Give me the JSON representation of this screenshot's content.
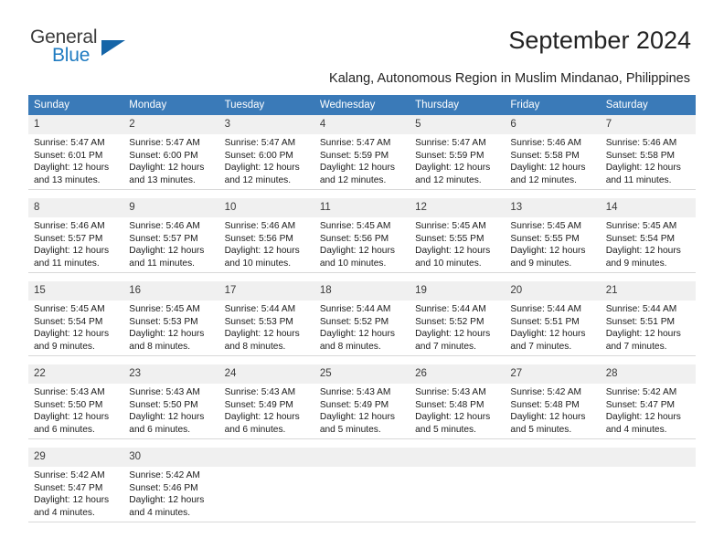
{
  "brand": {
    "name_top": "General",
    "name_bottom": "Blue",
    "color_dark": "#3c3c3c",
    "color_blue": "#1f7bc1",
    "triangle_color": "#1565a8"
  },
  "header": {
    "title": "September 2024",
    "subtitle": "Kalang, Autonomous Region in Muslim Mindanao, Philippines",
    "header_bg": "#3a7ab8",
    "header_text_color": "#ffffff",
    "daynum_bg": "#f0f0f0"
  },
  "weekday_headers": [
    "Sunday",
    "Monday",
    "Tuesday",
    "Wednesday",
    "Thursday",
    "Friday",
    "Saturday"
  ],
  "weeks": [
    [
      {
        "day": "1",
        "sunrise": "Sunrise: 5:47 AM",
        "sunset": "Sunset: 6:01 PM",
        "daylight_1": "Daylight: 12 hours",
        "daylight_2": "and 13 minutes."
      },
      {
        "day": "2",
        "sunrise": "Sunrise: 5:47 AM",
        "sunset": "Sunset: 6:00 PM",
        "daylight_1": "Daylight: 12 hours",
        "daylight_2": "and 13 minutes."
      },
      {
        "day": "3",
        "sunrise": "Sunrise: 5:47 AM",
        "sunset": "Sunset: 6:00 PM",
        "daylight_1": "Daylight: 12 hours",
        "daylight_2": "and 12 minutes."
      },
      {
        "day": "4",
        "sunrise": "Sunrise: 5:47 AM",
        "sunset": "Sunset: 5:59 PM",
        "daylight_1": "Daylight: 12 hours",
        "daylight_2": "and 12 minutes."
      },
      {
        "day": "5",
        "sunrise": "Sunrise: 5:47 AM",
        "sunset": "Sunset: 5:59 PM",
        "daylight_1": "Daylight: 12 hours",
        "daylight_2": "and 12 minutes."
      },
      {
        "day": "6",
        "sunrise": "Sunrise: 5:46 AM",
        "sunset": "Sunset: 5:58 PM",
        "daylight_1": "Daylight: 12 hours",
        "daylight_2": "and 12 minutes."
      },
      {
        "day": "7",
        "sunrise": "Sunrise: 5:46 AM",
        "sunset": "Sunset: 5:58 PM",
        "daylight_1": "Daylight: 12 hours",
        "daylight_2": "and 11 minutes."
      }
    ],
    [
      {
        "day": "8",
        "sunrise": "Sunrise: 5:46 AM",
        "sunset": "Sunset: 5:57 PM",
        "daylight_1": "Daylight: 12 hours",
        "daylight_2": "and 11 minutes."
      },
      {
        "day": "9",
        "sunrise": "Sunrise: 5:46 AM",
        "sunset": "Sunset: 5:57 PM",
        "daylight_1": "Daylight: 12 hours",
        "daylight_2": "and 11 minutes."
      },
      {
        "day": "10",
        "sunrise": "Sunrise: 5:46 AM",
        "sunset": "Sunset: 5:56 PM",
        "daylight_1": "Daylight: 12 hours",
        "daylight_2": "and 10 minutes."
      },
      {
        "day": "11",
        "sunrise": "Sunrise: 5:45 AM",
        "sunset": "Sunset: 5:56 PM",
        "daylight_1": "Daylight: 12 hours",
        "daylight_2": "and 10 minutes."
      },
      {
        "day": "12",
        "sunrise": "Sunrise: 5:45 AM",
        "sunset": "Sunset: 5:55 PM",
        "daylight_1": "Daylight: 12 hours",
        "daylight_2": "and 10 minutes."
      },
      {
        "day": "13",
        "sunrise": "Sunrise: 5:45 AM",
        "sunset": "Sunset: 5:55 PM",
        "daylight_1": "Daylight: 12 hours",
        "daylight_2": "and 9 minutes."
      },
      {
        "day": "14",
        "sunrise": "Sunrise: 5:45 AM",
        "sunset": "Sunset: 5:54 PM",
        "daylight_1": "Daylight: 12 hours",
        "daylight_2": "and 9 minutes."
      }
    ],
    [
      {
        "day": "15",
        "sunrise": "Sunrise: 5:45 AM",
        "sunset": "Sunset: 5:54 PM",
        "daylight_1": "Daylight: 12 hours",
        "daylight_2": "and 9 minutes."
      },
      {
        "day": "16",
        "sunrise": "Sunrise: 5:45 AM",
        "sunset": "Sunset: 5:53 PM",
        "daylight_1": "Daylight: 12 hours",
        "daylight_2": "and 8 minutes."
      },
      {
        "day": "17",
        "sunrise": "Sunrise: 5:44 AM",
        "sunset": "Sunset: 5:53 PM",
        "daylight_1": "Daylight: 12 hours",
        "daylight_2": "and 8 minutes."
      },
      {
        "day": "18",
        "sunrise": "Sunrise: 5:44 AM",
        "sunset": "Sunset: 5:52 PM",
        "daylight_1": "Daylight: 12 hours",
        "daylight_2": "and 8 minutes."
      },
      {
        "day": "19",
        "sunrise": "Sunrise: 5:44 AM",
        "sunset": "Sunset: 5:52 PM",
        "daylight_1": "Daylight: 12 hours",
        "daylight_2": "and 7 minutes."
      },
      {
        "day": "20",
        "sunrise": "Sunrise: 5:44 AM",
        "sunset": "Sunset: 5:51 PM",
        "daylight_1": "Daylight: 12 hours",
        "daylight_2": "and 7 minutes."
      },
      {
        "day": "21",
        "sunrise": "Sunrise: 5:44 AM",
        "sunset": "Sunset: 5:51 PM",
        "daylight_1": "Daylight: 12 hours",
        "daylight_2": "and 7 minutes."
      }
    ],
    [
      {
        "day": "22",
        "sunrise": "Sunrise: 5:43 AM",
        "sunset": "Sunset: 5:50 PM",
        "daylight_1": "Daylight: 12 hours",
        "daylight_2": "and 6 minutes."
      },
      {
        "day": "23",
        "sunrise": "Sunrise: 5:43 AM",
        "sunset": "Sunset: 5:50 PM",
        "daylight_1": "Daylight: 12 hours",
        "daylight_2": "and 6 minutes."
      },
      {
        "day": "24",
        "sunrise": "Sunrise: 5:43 AM",
        "sunset": "Sunset: 5:49 PM",
        "daylight_1": "Daylight: 12 hours",
        "daylight_2": "and 6 minutes."
      },
      {
        "day": "25",
        "sunrise": "Sunrise: 5:43 AM",
        "sunset": "Sunset: 5:49 PM",
        "daylight_1": "Daylight: 12 hours",
        "daylight_2": "and 5 minutes."
      },
      {
        "day": "26",
        "sunrise": "Sunrise: 5:43 AM",
        "sunset": "Sunset: 5:48 PM",
        "daylight_1": "Daylight: 12 hours",
        "daylight_2": "and 5 minutes."
      },
      {
        "day": "27",
        "sunrise": "Sunrise: 5:42 AM",
        "sunset": "Sunset: 5:48 PM",
        "daylight_1": "Daylight: 12 hours",
        "daylight_2": "and 5 minutes."
      },
      {
        "day": "28",
        "sunrise": "Sunrise: 5:42 AM",
        "sunset": "Sunset: 5:47 PM",
        "daylight_1": "Daylight: 12 hours",
        "daylight_2": "and 4 minutes."
      }
    ],
    [
      {
        "day": "29",
        "sunrise": "Sunrise: 5:42 AM",
        "sunset": "Sunset: 5:47 PM",
        "daylight_1": "Daylight: 12 hours",
        "daylight_2": "and 4 minutes."
      },
      {
        "day": "30",
        "sunrise": "Sunrise: 5:42 AM",
        "sunset": "Sunset: 5:46 PM",
        "daylight_1": "Daylight: 12 hours",
        "daylight_2": "and 4 minutes."
      },
      {
        "day": "",
        "sunrise": "",
        "sunset": "",
        "daylight_1": "",
        "daylight_2": ""
      },
      {
        "day": "",
        "sunrise": "",
        "sunset": "",
        "daylight_1": "",
        "daylight_2": ""
      },
      {
        "day": "",
        "sunrise": "",
        "sunset": "",
        "daylight_1": "",
        "daylight_2": ""
      },
      {
        "day": "",
        "sunrise": "",
        "sunset": "",
        "daylight_1": "",
        "daylight_2": ""
      },
      {
        "day": "",
        "sunrise": "",
        "sunset": "",
        "daylight_1": "",
        "daylight_2": ""
      }
    ]
  ]
}
